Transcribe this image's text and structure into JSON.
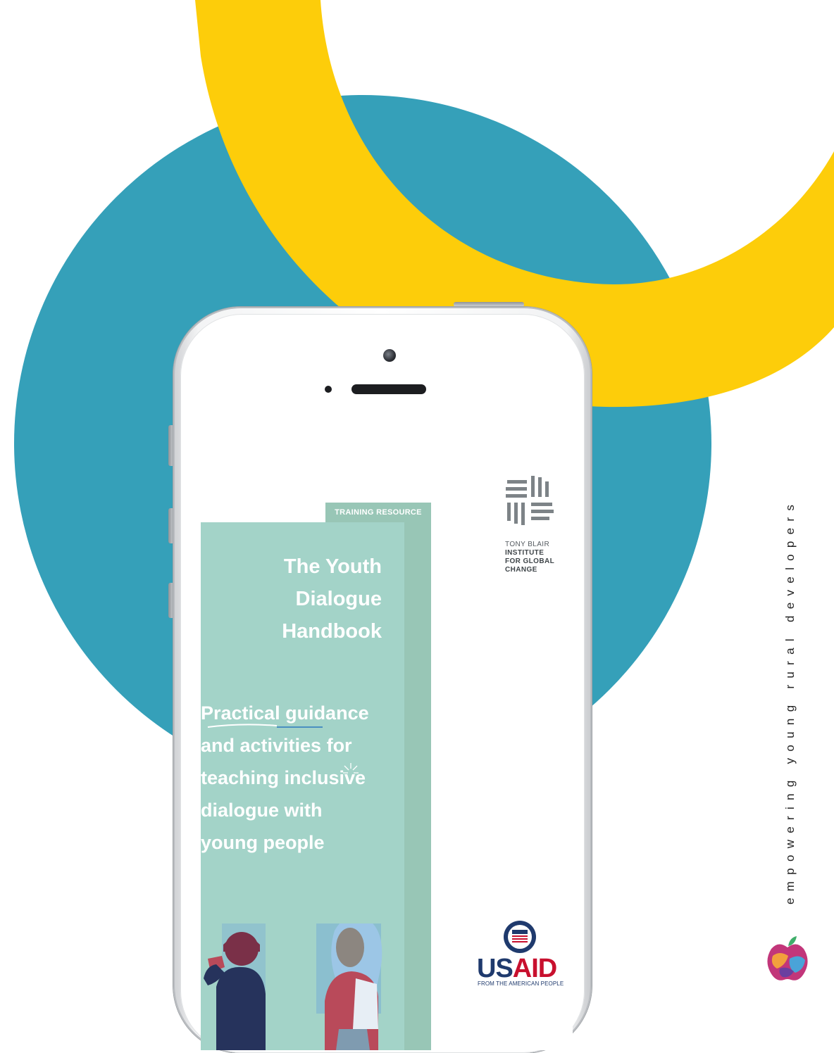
{
  "colors": {
    "teal": "#35a0b9",
    "yellow": "#fdcd0a",
    "cover_mint": "#a3d3c8",
    "cover_sage": "#98c6b6",
    "usaid_blue": "#1f3a6d",
    "usaid_red": "#c8102e"
  },
  "phone": {
    "cover": {
      "tag": "TRAINING RESOURCE",
      "title_lines": [
        "The Youth",
        "Dialogue",
        "Handbook"
      ],
      "subtitle_lines": [
        "Practical guidance",
        "and activities for",
        "teaching inclusive",
        "dialogue with",
        "young people"
      ]
    },
    "tbi": {
      "line1": "TONY BLAIR",
      "line2": "INSTITUTE",
      "line3": "FOR GLOBAL",
      "line4": "CHANGE"
    },
    "usaid": {
      "us": "US",
      "aid": "AID",
      "tagline": "FROM THE AMERICAN PEOPLE"
    }
  },
  "side_text": "empowering young rural developers",
  "icons": [
    "tbi-logo-icon",
    "usaid-seal-icon",
    "brand-apple-logo-icon"
  ]
}
